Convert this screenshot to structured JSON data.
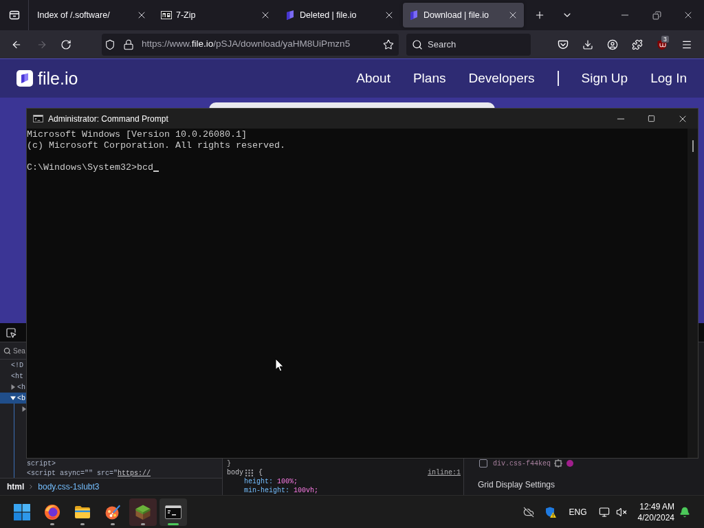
{
  "browser": {
    "tabs": [
      {
        "title": "Index of /.software/",
        "selected": false
      },
      {
        "title": "7-Zip",
        "selected": false
      },
      {
        "title": "Deleted | file.io",
        "selected": false
      },
      {
        "title": "Download | file.io",
        "selected": true
      }
    ],
    "toolbar": {
      "back": {
        "disabled": false
      },
      "forward": {
        "disabled": true
      },
      "url": {
        "scheme_host": "https://www.",
        "domain": "file.io",
        "path": "/pSJA/download/yaHM8UiPmzn5"
      },
      "search": {
        "placeholder": "Search"
      },
      "extension_badge": "3"
    }
  },
  "site": {
    "logo": "file.io",
    "nav": [
      {
        "label": "About"
      },
      {
        "label": "Plans"
      },
      {
        "label": "Developers"
      }
    ],
    "account_nav": [
      {
        "label": "Sign Up"
      },
      {
        "label": "Log In"
      }
    ]
  },
  "devtools": {
    "search": {
      "placeholder": "Sea"
    },
    "markup": [
      {
        "text": "<!D",
        "selected": false
      },
      {
        "text": "<ht",
        "selected": false,
        "children": [
          {
            "text": "<h",
            "expanded": false,
            "selected": false
          },
          {
            "text": "<b",
            "expanded": true,
            "selected": true,
            "children": [
              {
                "expanded": false,
                "selected": false
              },
              {
                "text": "script>",
                "selected": false
              },
              {
                "text": "<script async=\"\" src=\"",
                "link": "https://",
                "selected": false
              }
            ]
          }
        ]
      }
    ],
    "breadcrumbs": [
      {
        "label": "html",
        "selected": false
      },
      {
        "label": "body.css-1slubt3",
        "selected": true
      }
    ],
    "rules": {
      "previous_end": "}",
      "selector": "body",
      "brace": "{",
      "source": "inline:1",
      "declarations": [
        {
          "property": "height:",
          "value": "100%;"
        },
        {
          "property": "min-height:",
          "value": "100vh;"
        }
      ]
    },
    "layout": {
      "grids": [
        {
          "label": "div.css-f44keq",
          "checked": false,
          "color": "#a01f8c"
        }
      ],
      "heading": "Grid Display Settings"
    }
  },
  "cmd": {
    "title": "Administrator: Command Prompt",
    "output": [
      "Microsoft Windows [Version 10.0.26080.1]",
      "(c) Microsoft Corporation. All rights reserved."
    ],
    "prompt": "C:\\Windows\\System32>",
    "input": "bcd"
  },
  "taskbar": {
    "apps": [
      {
        "running": true,
        "active": false,
        "attention": false
      },
      {
        "running": true,
        "active": false,
        "attention": false
      },
      {
        "running": true,
        "active": false,
        "attention": false
      },
      {
        "running": true,
        "active": false,
        "attention": true
      },
      {
        "running": true,
        "active": true,
        "attention": false
      }
    ],
    "tray": {
      "language": "ENG",
      "time": "12:49 AM",
      "date": "4/20/2024"
    }
  }
}
